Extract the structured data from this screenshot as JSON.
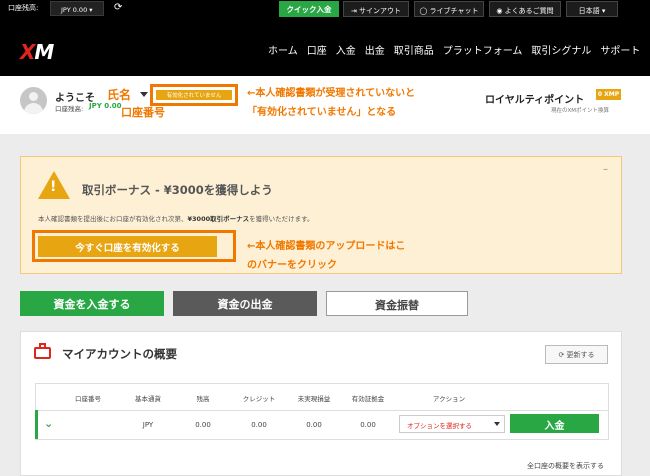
{
  "topbar": {
    "balance_label": "口座残高:",
    "balance_value": "JPY 0.00 ▾",
    "quick_deposit": "クイック入金",
    "signout": "⇥ サインアウト",
    "livechat": "◯ ライブチャット",
    "faq": "◉ よくあるご質問",
    "language": "日本語 ▾"
  },
  "navbar": {
    "logo_x": "X",
    "logo_m": "M",
    "items": [
      "ホーム",
      "口座",
      "入金",
      "出金",
      "取引商品",
      "プラットフォーム",
      "取引シグナル",
      "サポート"
    ]
  },
  "profile": {
    "welcome": "ようこそ",
    "name_annotation": "氏名",
    "status_badge": "有効化されていません",
    "balance_label": "口座残高:",
    "balance_value": "JPY 0.00",
    "account_number_annotation": "口座番号",
    "status_annotation": "←本人確認書類が受理されていないと「有効化されていません」となる",
    "loyalty_title": "ロイヤルティポイント",
    "loyalty_badge": "0 XMP",
    "loyalty_sub": "現在のXMポイント換算"
  },
  "bonus": {
    "minimize": "–",
    "warn_mark": "!",
    "title": "取引ボーナス - ¥3000を獲得しよう",
    "desc_pre": "本人確認書類を提出後にお口座が有効化され次第、",
    "desc_bold": "¥3000取引ボーナス",
    "desc_post": "を獲得いただけます。",
    "activate_button": "今すぐ口座を有効化する",
    "activate_annotation": "←本人確認書類のアップロードはこのバナーをクリック"
  },
  "actions": {
    "deposit": "資金を入金する",
    "withdraw": "資金の出金",
    "transfer": "資金振替"
  },
  "overview": {
    "title": "マイアカウントの概要",
    "refresh": "⟳ 更新する",
    "columns": [
      "口座番号",
      "基本通貨",
      "残高",
      "クレジット",
      "未実現損益",
      "有効証拠金",
      "アクション"
    ],
    "row": {
      "chevron": "⌄",
      "currency": "JPY",
      "balance": "0.00",
      "credit": "0.00",
      "unrealized": "0.00",
      "equity": "0.00",
      "option_select": "オプションを選択する",
      "deposit": "入金"
    },
    "show_all": "全口座の概要を表示する"
  },
  "colors": {
    "accent_green": "#29a745",
    "annotation_orange": "#f07800",
    "badge_gold": "#e8a512",
    "brand_red": "#e0251b"
  }
}
